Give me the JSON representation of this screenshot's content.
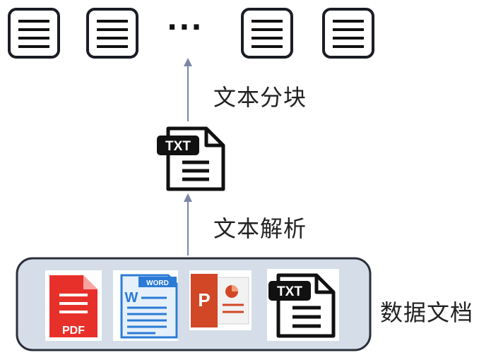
{
  "diagram": {
    "chunk_step_label": "文本分块",
    "parse_step_label": "文本解析",
    "source_label": "数据文档",
    "ellipsis": "···",
    "chunks": [
      "chunk-1",
      "chunk-2",
      "chunk-3",
      "chunk-4"
    ],
    "source_documents": [
      {
        "type": "PDF",
        "badge": "PDF",
        "icon": "pdf-file-icon",
        "color": "#e8302b"
      },
      {
        "type": "Word",
        "badge": "WORD",
        "letter": "W",
        "icon": "word-file-icon",
        "color": "#2b7bd6"
      },
      {
        "type": "PowerPoint",
        "letter": "P",
        "icon": "powerpoint-file-icon",
        "color": "#d24726"
      },
      {
        "type": "TXT",
        "badge": "TXT",
        "icon": "txt-file-icon",
        "color": "#111111"
      }
    ],
    "parsed_document": {
      "badge": "TXT",
      "icon": "txt-file-icon"
    },
    "colors": {
      "arrow": "#7b86a8",
      "panel_fill": "#d4dde8",
      "panel_border": "#2b2f3a"
    }
  }
}
